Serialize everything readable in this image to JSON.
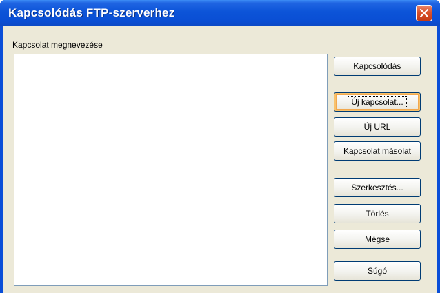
{
  "window": {
    "title": "Kapcsolódás FTP-szerverhez"
  },
  "list": {
    "label": "Kapcsolat megnevezése",
    "items": []
  },
  "buttons": {
    "connect": "Kapcsolódás",
    "new_connection": "Új kapcsolat...",
    "new_url": "Új URL",
    "copy_connection": "Kapcsolat másolat",
    "edit": "Szerkesztés...",
    "delete": "Törlés",
    "cancel": "Mégse",
    "help": "Súgó"
  },
  "colors": {
    "titlebar": "#0a4ed8",
    "client": "#ece9d8",
    "close_button": "#d9532c",
    "default_button_highlight": "#f8c26c"
  },
  "icons": {
    "close": "close-icon"
  }
}
